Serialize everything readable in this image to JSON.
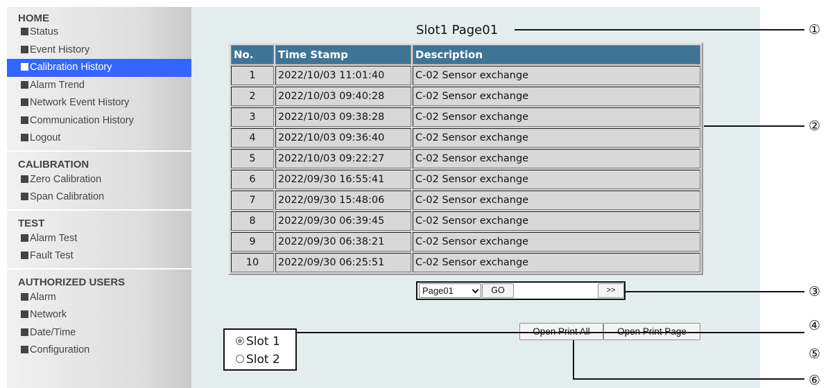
{
  "sidebar": {
    "sections": [
      {
        "title": "HOME",
        "items": [
          {
            "label": "Status",
            "active": false
          },
          {
            "label": "Event History",
            "active": false
          },
          {
            "label": "Calibration History",
            "active": true
          },
          {
            "label": "Alarm Trend",
            "active": false
          },
          {
            "label": "Network Event History",
            "active": false
          },
          {
            "label": "Communication History",
            "active": false
          },
          {
            "label": "Logout",
            "active": false
          }
        ]
      },
      {
        "title": "CALIBRATION",
        "items": [
          {
            "label": "Zero Calibration",
            "active": false
          },
          {
            "label": "Span Calibration",
            "active": false
          }
        ]
      },
      {
        "title": "TEST",
        "items": [
          {
            "label": "Alarm Test",
            "active": false
          },
          {
            "label": "Fault Test",
            "active": false
          }
        ]
      },
      {
        "title": "AUTHORIZED USERS",
        "items": [
          {
            "label": "Alarm",
            "active": false
          },
          {
            "label": "Network",
            "active": false
          },
          {
            "label": "Date/Time",
            "active": false
          },
          {
            "label": "Configuration",
            "active": false
          }
        ]
      }
    ]
  },
  "main": {
    "heading": "Slot1 Page01",
    "table": {
      "columns": [
        "No.",
        "Time Stamp",
        "Description"
      ],
      "rows": [
        [
          "1",
          "2022/10/03 11:01:40",
          "C-02 Sensor exchange"
        ],
        [
          "2",
          "2022/10/03 09:40:28",
          "C-02 Sensor exchange"
        ],
        [
          "3",
          "2022/10/03 09:38:28",
          "C-02 Sensor exchange"
        ],
        [
          "4",
          "2022/10/03 09:36:40",
          "C-02 Sensor exchange"
        ],
        [
          "5",
          "2022/10/03 09:22:27",
          "C-02 Sensor exchange"
        ],
        [
          "6",
          "2022/09/30 16:55:41",
          "C-02 Sensor exchange"
        ],
        [
          "7",
          "2022/09/30 15:48:06",
          "C-02 Sensor exchange"
        ],
        [
          "8",
          "2022/09/30 06:39:45",
          "C-02 Sensor exchange"
        ],
        [
          "9",
          "2022/09/30 06:38:21",
          "C-02 Sensor exchange"
        ],
        [
          "10",
          "2022/09/30 06:25:51",
          "C-02 Sensor exchange"
        ]
      ]
    },
    "pager": {
      "selected_page": "Page01",
      "go_label": "GO",
      "next_label": ">>"
    },
    "slots": [
      {
        "label": "Slot 1",
        "checked": true
      },
      {
        "label": "Slot 2",
        "checked": false
      }
    ],
    "buttons": {
      "print_all": "Open Print All",
      "print_page": "Open Print Page"
    }
  },
  "callouts": [
    "①",
    "②",
    "③",
    "④",
    "⑤",
    "⑥"
  ],
  "colors": {
    "active_nav": "#3366ff",
    "table_header": "#3e7597",
    "main_bg": "#e3eded"
  }
}
